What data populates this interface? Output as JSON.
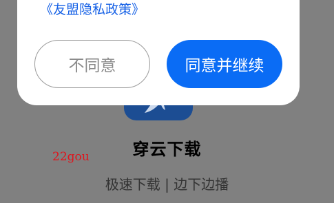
{
  "dialog": {
    "policy_link": "《友盟隐私政策》",
    "disagree_label": "不同意",
    "agree_label": "同意并继续"
  },
  "background_app": {
    "name": "穿云下载",
    "slogan": "极速下载 | 边下边播",
    "watermark": "22gou",
    "logo_icon": "app-logo-icon"
  },
  "colors": {
    "accent": "#0a6cf5",
    "link": "#1661e6",
    "overlay": "#808080",
    "logo": "#1c4d93",
    "watermark": "#e0141c"
  }
}
